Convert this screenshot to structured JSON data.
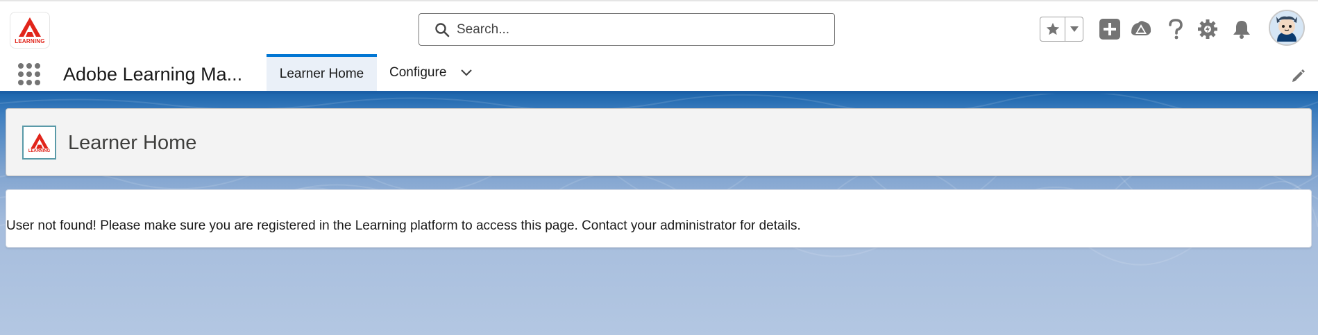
{
  "header": {
    "logo_label": "LEARNING",
    "search": {
      "placeholder": "Search...",
      "value": ""
    },
    "icons": [
      "star-icon",
      "chevron-down-icon",
      "add-icon",
      "trailhead-icon",
      "help-icon",
      "setup-gear-icon",
      "notification-bell-icon",
      "avatar"
    ]
  },
  "nav": {
    "app_name": "Adobe Learning Ma...",
    "tabs": [
      {
        "label": "Learner Home",
        "active": true
      },
      {
        "label": "Configure",
        "active": false,
        "has_menu": true
      }
    ]
  },
  "page_header": {
    "logo_label": "LEARNING",
    "title": "Learner Home"
  },
  "message": {
    "text": "User not found! Please make sure you are registered in the Learning platform to access this page. Contact your administrator for details."
  },
  "colors": {
    "brand_blue": "#1b5fa6",
    "active_tab_accent": "#0176d3",
    "logo_red": "#e1251b",
    "icon_gray": "#747474"
  }
}
